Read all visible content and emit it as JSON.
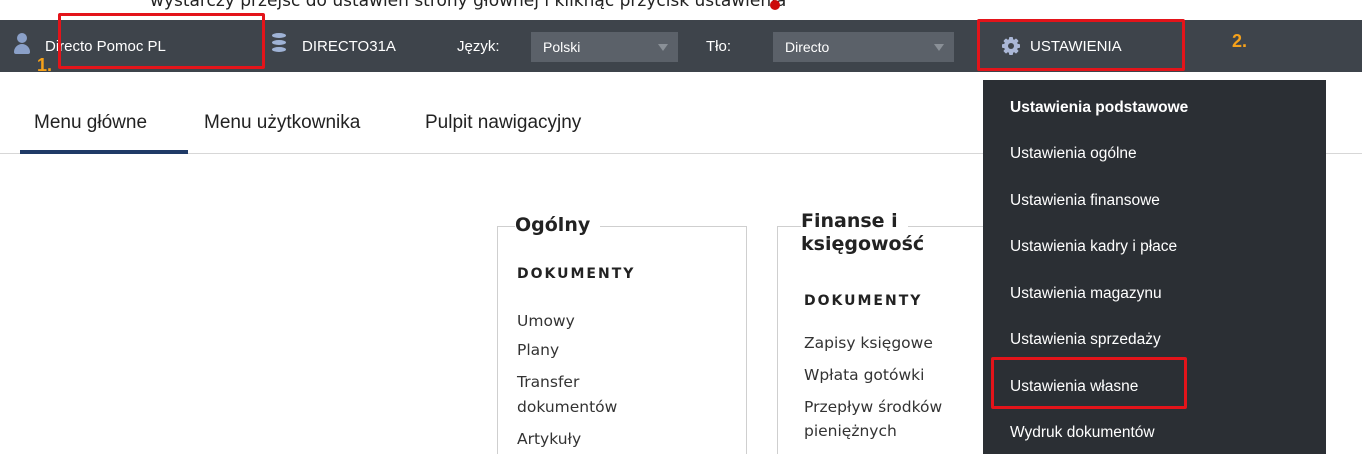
{
  "caption": "wystarczy przejść do ustawień strony głównej i kliknąć przycisk ustawienia",
  "topbar": {
    "user_name": "Directo Pomoc PL",
    "database": "DIRECTO31A",
    "language_label": "Język:",
    "language_value": "Polski",
    "background_label": "Tło:",
    "background_value": "Directo",
    "settings_label": "USTAWIENIA",
    "icons": [
      "user-icon",
      "database-icon",
      "gear-icon"
    ]
  },
  "annotations": {
    "step1": "1.",
    "step2": "2.",
    "color": "#e3141a"
  },
  "tabs": [
    {
      "label": "Menu główne",
      "active": true
    },
    {
      "label": "Menu użytkownika",
      "active": false
    },
    {
      "label": "Pulpit nawigacyjny",
      "active": false
    }
  ],
  "columns": [
    {
      "title": "Ogólny",
      "section": "DOKUMENTY",
      "links": [
        "Umowy",
        "Plany",
        "Transfer",
        "dokumentów",
        "Artykuły"
      ]
    },
    {
      "title_line1": "Finanse i",
      "title_line2": "księgowość",
      "section": "DOKUMENTY",
      "links": [
        "Zapisy księgowe",
        "Wpłata gotówki",
        "Przepływ środków",
        "pieniężnych"
      ]
    }
  ],
  "settings_menu": {
    "items": [
      "Ustawienia podstawowe",
      "Ustawienia ogólne",
      "Ustawienia finansowe",
      "Ustawienia kadry i płace",
      "Ustawienia magazynu",
      "Ustawienia sprzedaży",
      "Ustawienia własne",
      "Wydruk dokumentów"
    ],
    "highlighted": "Ustawienia własne"
  },
  "colors": {
    "topbar": "#3e444b",
    "dropdown": "#2b2f34",
    "accent_underline": "#1f3a67",
    "annotation_number": "#f5a11a"
  }
}
